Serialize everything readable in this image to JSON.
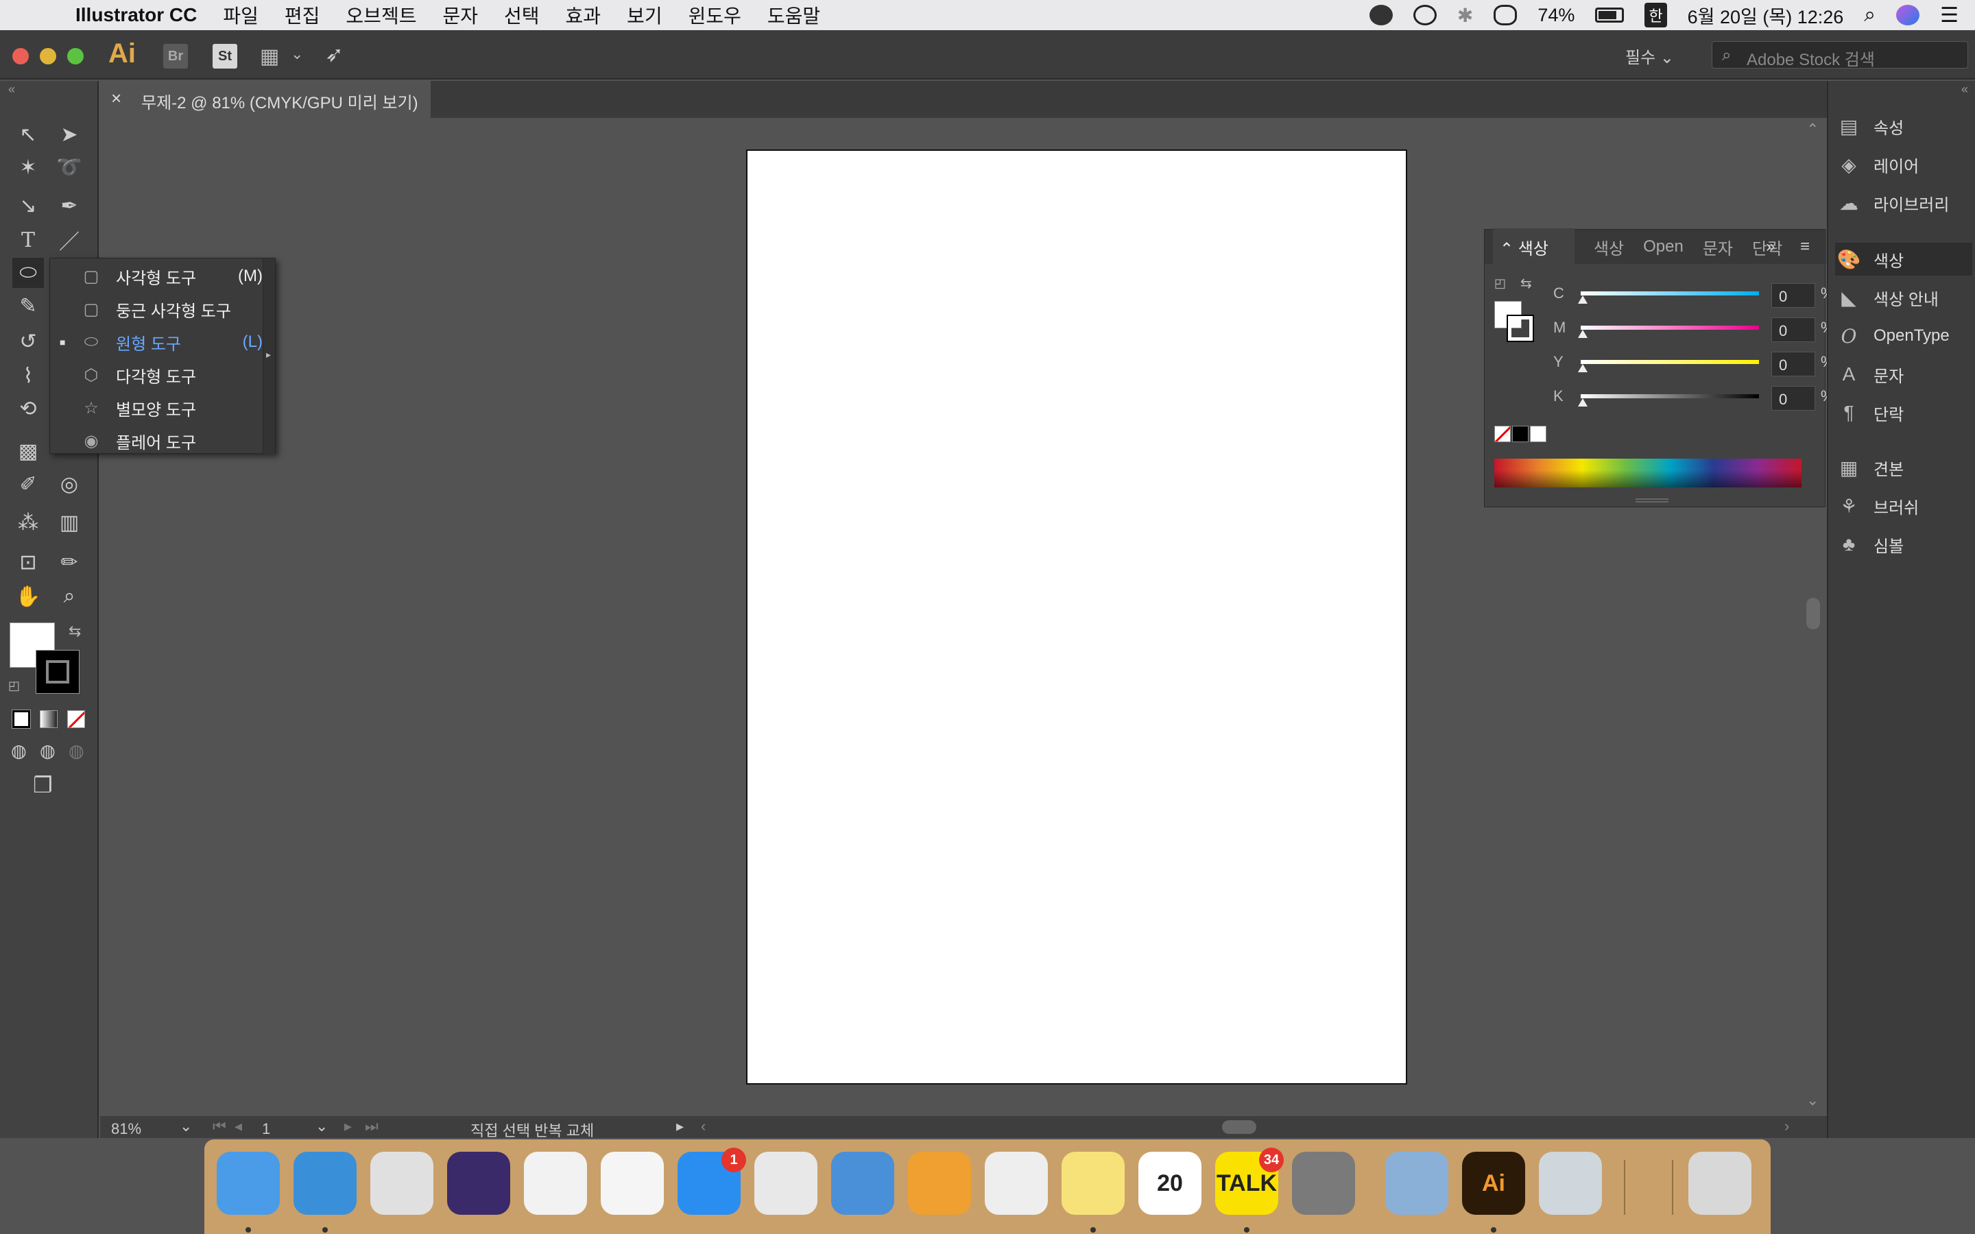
{
  "menubar": {
    "app_name": "Illustrator CC",
    "items": [
      "파일",
      "편집",
      "오브젝트",
      "문자",
      "선택",
      "효과",
      "보기",
      "윈도우",
      "도움말"
    ],
    "battery": "74%",
    "ime": "한",
    "datetime": "6월 20일 (목) 12:26"
  },
  "appbar": {
    "logo": "Ai",
    "bridge": "Br",
    "stock": "St",
    "workspace": "필수",
    "search_placeholder": "Adobe Stock 검색"
  },
  "document": {
    "tab_title": "무제-2 @ 81% (CMYK/GPU 미리 보기)"
  },
  "flyout": {
    "items": [
      {
        "label": "사각형 도구",
        "key": "(M)",
        "icon": "rectangle-icon",
        "active": false
      },
      {
        "label": "둥근 사각형 도구",
        "key": "",
        "icon": "rounded-rectangle-icon",
        "active": false
      },
      {
        "label": "원형 도구",
        "key": "(L)",
        "icon": "ellipse-icon",
        "active": true
      },
      {
        "label": "다각형 도구",
        "key": "",
        "icon": "polygon-icon",
        "active": false
      },
      {
        "label": "별모양 도구",
        "key": "",
        "icon": "star-icon",
        "active": false
      },
      {
        "label": "플레어 도구",
        "key": "",
        "icon": "flare-icon",
        "active": false
      }
    ]
  },
  "color_panel": {
    "tabs": [
      "색상",
      "색상",
      "Open",
      "문자",
      "단락"
    ],
    "channels": [
      {
        "label": "C",
        "value": "0",
        "unit": "%",
        "gradient": "linear-gradient(to right,#ffffff,#00aeef)"
      },
      {
        "label": "M",
        "value": "0",
        "unit": "%",
        "gradient": "linear-gradient(to right,#ffffff,#ec008c)"
      },
      {
        "label": "Y",
        "value": "0",
        "unit": "%",
        "gradient": "linear-gradient(to right,#ffffff,#fff200)"
      },
      {
        "label": "K",
        "value": "0",
        "unit": "%",
        "gradient": "linear-gradient(to right,#ffffff,#000000)"
      }
    ]
  },
  "right_dock": {
    "items": [
      {
        "label": "속성",
        "icon": "properties-icon",
        "selected": false
      },
      {
        "label": "레이어",
        "icon": "layers-icon",
        "selected": false
      },
      {
        "label": "라이브러리",
        "icon": "libraries-icon",
        "selected": false
      },
      {
        "label": "색상",
        "icon": "color-icon",
        "selected": true
      },
      {
        "label": "색상 안내",
        "icon": "color-guide-icon",
        "selected": false
      },
      {
        "label": "OpenType",
        "icon": "opentype-icon",
        "selected": false
      },
      {
        "label": "문자",
        "icon": "character-icon",
        "selected": false
      },
      {
        "label": "단락",
        "icon": "paragraph-icon",
        "selected": false
      },
      {
        "label": "견본",
        "icon": "swatches-icon",
        "selected": false
      },
      {
        "label": "브러쉬",
        "icon": "brushes-icon",
        "selected": false
      },
      {
        "label": "심볼",
        "icon": "symbols-icon",
        "selected": false
      }
    ]
  },
  "status": {
    "zoom": "81%",
    "page": "1",
    "tool_info": "직접 선택 반복 교체"
  },
  "dock": {
    "apps": [
      {
        "name": "finder-icon",
        "color": "#4a9be8",
        "label": "",
        "badge": "",
        "running": true
      },
      {
        "name": "safari-icon",
        "color": "#3a8fd9",
        "label": "",
        "badge": "",
        "running": true
      },
      {
        "name": "chrome-icon",
        "color": "#e0e0e0",
        "label": "",
        "badge": "",
        "running": false
      },
      {
        "name": "siri-icon",
        "color": "#3a2a6a",
        "label": "",
        "badge": "",
        "running": false
      },
      {
        "name": "itunes-icon",
        "color": "#f2f2f2",
        "label": "",
        "badge": "",
        "running": false
      },
      {
        "name": "photos-icon",
        "color": "#f5f5f5",
        "label": "",
        "badge": "",
        "running": false
      },
      {
        "name": "app-store-icon",
        "color": "#2a8ef0",
        "label": "",
        "badge": "1",
        "running": false
      },
      {
        "name": "numbers-icon",
        "color": "#e8e8e8",
        "label": "",
        "badge": "",
        "running": false
      },
      {
        "name": "keynote-icon",
        "color": "#4a90d9",
        "label": "",
        "badge": "",
        "running": false
      },
      {
        "name": "pages-icon",
        "color": "#f0a030",
        "label": "",
        "badge": "",
        "running": false
      },
      {
        "name": "textedit-icon",
        "color": "#eeeeee",
        "label": "",
        "badge": "",
        "running": false
      },
      {
        "name": "notes-icon",
        "color": "#f7e27a",
        "label": "",
        "badge": "",
        "running": true
      },
      {
        "name": "calendar-icon",
        "color": "#ffffff",
        "label": "20",
        "badge": "",
        "running": false
      },
      {
        "name": "kakaotalk-icon",
        "color": "#fae100",
        "label": "TALK",
        "badge": "34",
        "running": true
      },
      {
        "name": "system-preferences-icon",
        "color": "#7a7a7a",
        "label": "",
        "badge": "",
        "running": false
      },
      {
        "name": "preview-icon",
        "color": "#8ab0d8",
        "label": "",
        "badge": "",
        "running": false
      },
      {
        "name": "illustrator-icon",
        "color": "#2b1a07",
        "label": "Ai",
        "badge": "",
        "running": true
      },
      {
        "name": "script-editor-icon",
        "color": "#cfd6dc",
        "label": "",
        "badge": "",
        "running": false
      },
      {
        "name": "trash-icon",
        "color": "#d8d8d8",
        "label": "",
        "badge": "",
        "running": false
      }
    ]
  }
}
